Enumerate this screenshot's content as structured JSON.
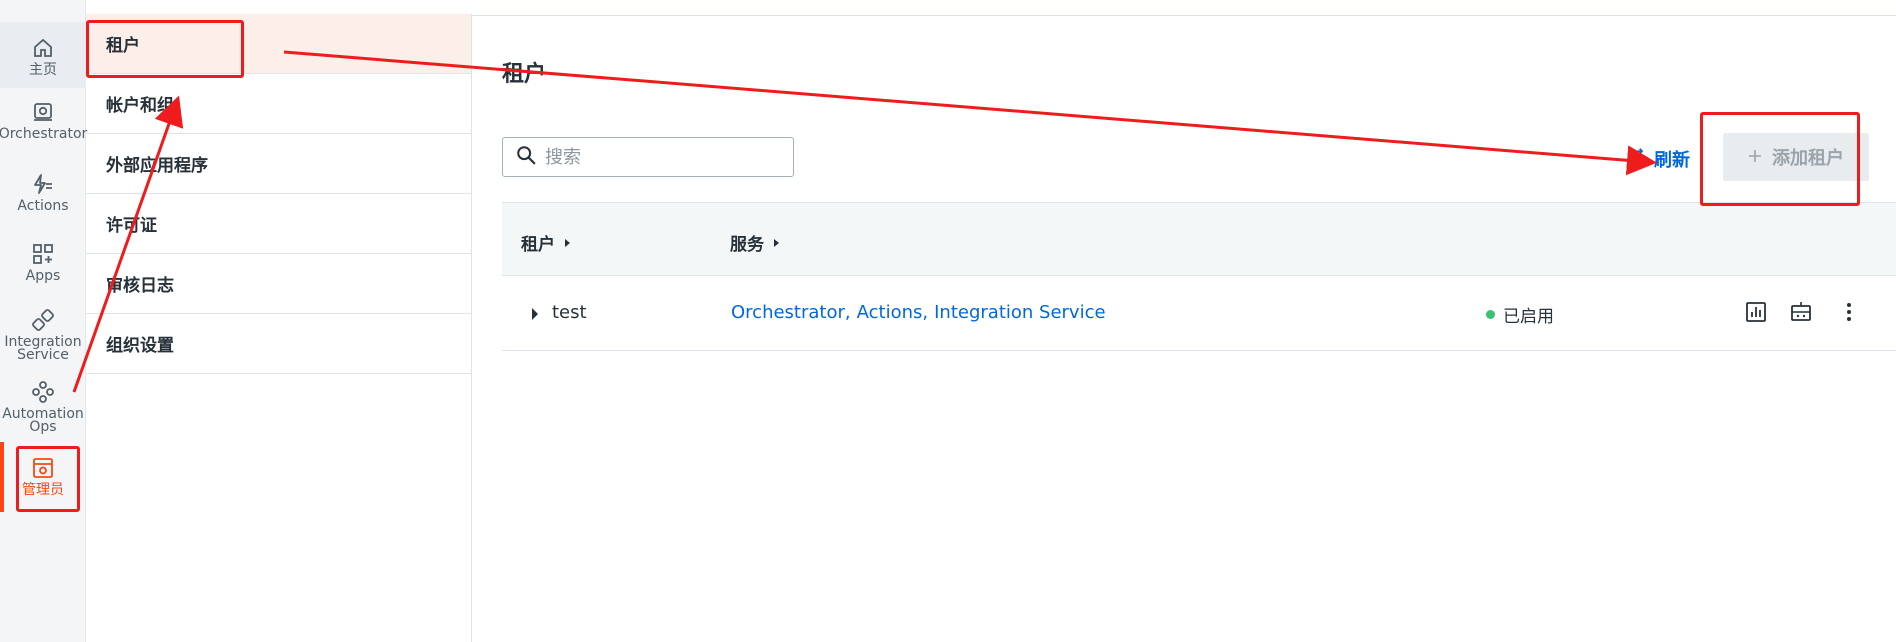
{
  "rail": {
    "top_label": "...",
    "items": [
      {
        "label": "主页",
        "icon": "home-icon"
      },
      {
        "label": "Orchestrator",
        "icon": "orchestrator-icon"
      },
      {
        "label": "Actions",
        "icon": "actions-icon"
      },
      {
        "label": "Apps",
        "icon": "apps-icon"
      },
      {
        "label": "Integration Service",
        "icon": "integration-service-icon"
      },
      {
        "label": "Automation Ops",
        "icon": "automation-ops-icon"
      },
      {
        "label": "管理员",
        "icon": "admin-icon"
      }
    ]
  },
  "subnav": {
    "items": [
      {
        "label": "租户"
      },
      {
        "label": "帐户和组"
      },
      {
        "label": "外部应用程序"
      },
      {
        "label": "许可证"
      },
      {
        "label": "审核日志"
      },
      {
        "label": "组织设置"
      }
    ]
  },
  "main": {
    "title": "租户",
    "search_placeholder": "搜索",
    "refresh_label": "刷新",
    "add_tenant_label": "添加租户",
    "table": {
      "columns": [
        "租户",
        "服务"
      ],
      "rows": [
        {
          "name": "test",
          "services": [
            "Orchestrator",
            "Actions",
            "Integration Service"
          ],
          "status": "已启用"
        }
      ]
    }
  },
  "colors": {
    "accent": "#fa4616",
    "link": "#0067df",
    "status_enabled": "#38c172",
    "annotation": "#ee1c1c"
  }
}
